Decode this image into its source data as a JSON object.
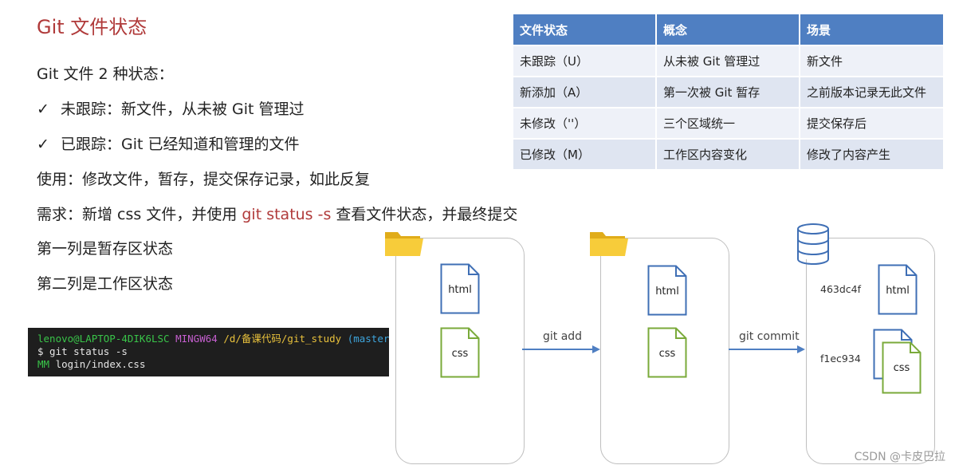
{
  "title": "Git 文件状态",
  "lines": [
    "Git 文件 2 种状态：",
    "未跟踪：新文件，从未被 Git 管理过",
    "已跟踪：Git 已经知道和管理的文件",
    "使用：修改文件，暂存，提交保存记录，如此反复",
    "需求：新增 css 文件，并使用 ",
    "第一列是暂存区状态",
    "第二列是工作区状态"
  ],
  "check_mark": "✓",
  "command_highlight": "git status -s",
  "command_tail": " 查看文件状态，并最终提交",
  "table": {
    "headers": [
      "文件状态",
      "概念",
      "场景"
    ],
    "rows": [
      [
        "未跟踪（U）",
        "从未被 Git 管理过",
        "新文件"
      ],
      [
        "新添加（A）",
        "第一次被 Git 暂存",
        "之前版本记录无此文件"
      ],
      [
        "未修改（''）",
        "三个区域统一",
        "提交保存后"
      ],
      [
        "已修改（M）",
        "工作区内容变化",
        "修改了内容产生"
      ]
    ]
  },
  "terminal": {
    "user": "lenovo@LAPTOP-4DIK6LSC",
    "shell": "MINGW64",
    "path": "/d/备课代码/git_study",
    "branch": "(master)",
    "command": "$ git status -s",
    "status_code": "MM",
    "status_file": " login/index.css"
  },
  "diagram": {
    "file_html": "html",
    "file_css": "css",
    "arrow_add": "git add",
    "arrow_commit": "git commit",
    "hash_html": "463dc4f",
    "hash_css": "f1ec934",
    "colors": {
      "html_file": "#3f6fb5",
      "css_file": "#7aaa3a",
      "arrow": "#4f7fc2",
      "folder": "#f4c430"
    }
  },
  "watermark": "CSDN @卡皮巴拉"
}
